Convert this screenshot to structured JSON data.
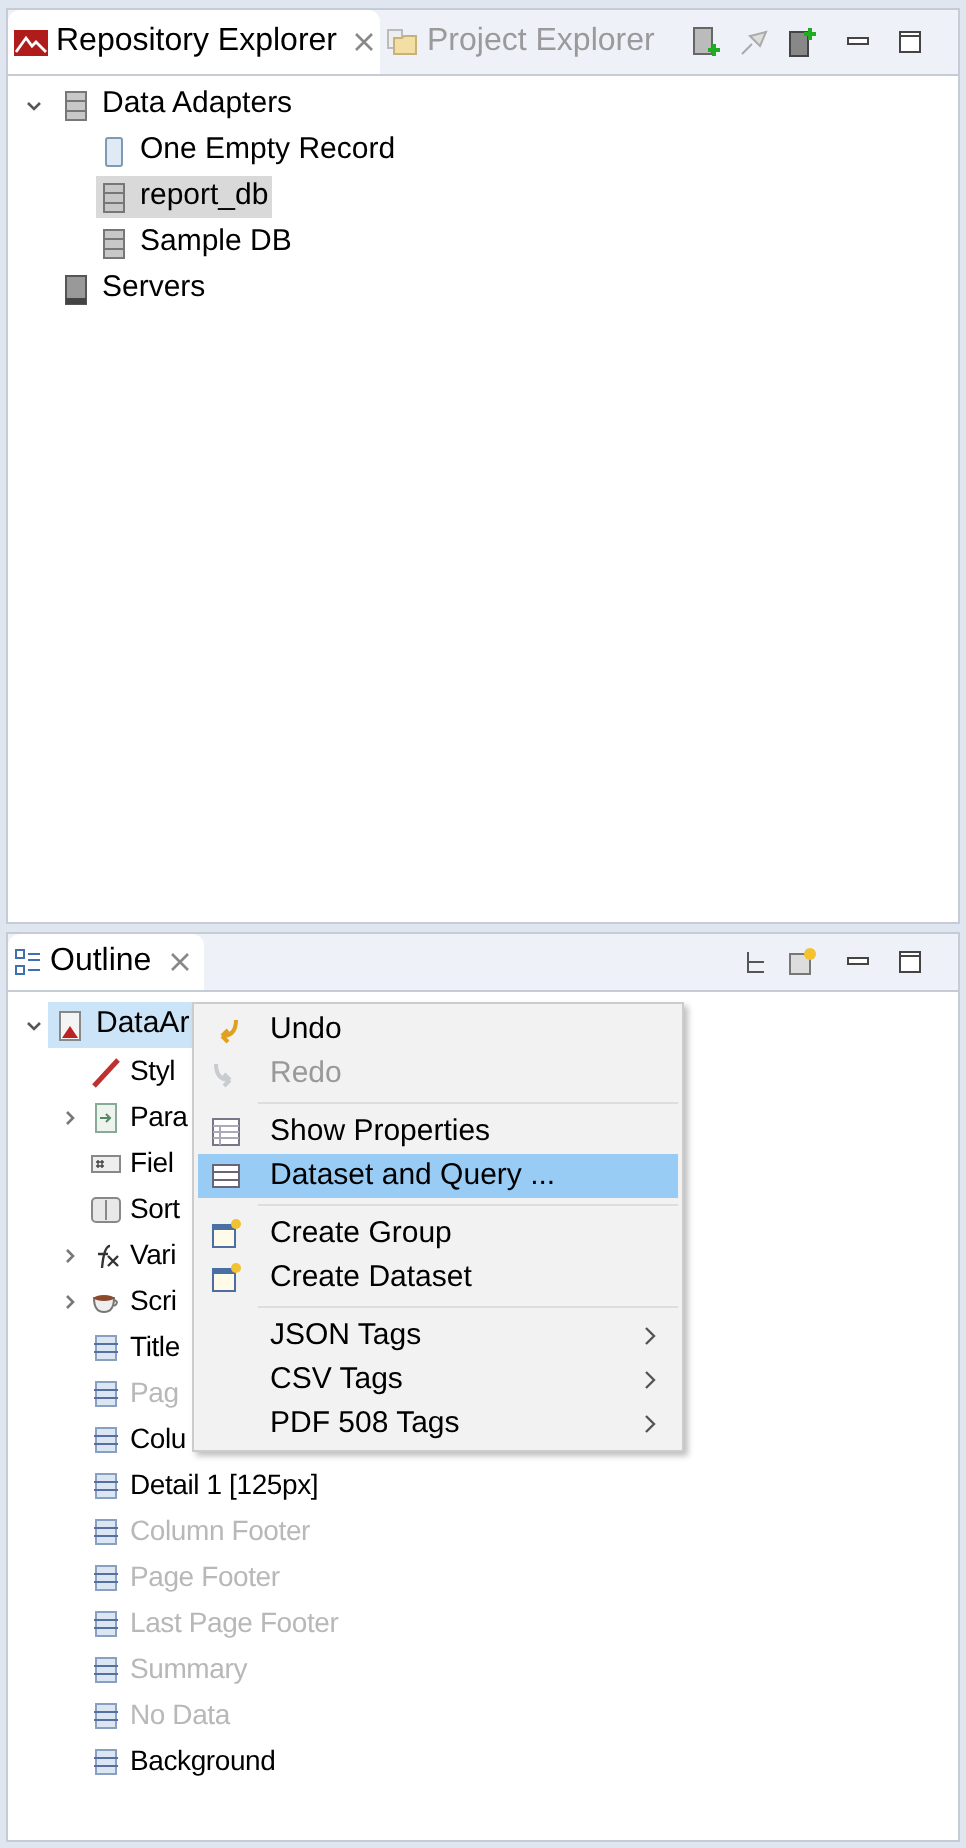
{
  "repository_panel": {
    "tabs": [
      {
        "label": "Repository Explorer",
        "selected": true
      },
      {
        "label": "Project Explorer",
        "selected": false
      }
    ],
    "tree": [
      {
        "label": "Data Adapters",
        "expanded": true,
        "selected": false,
        "children": [
          {
            "label": "One Empty Record",
            "selected": false
          },
          {
            "label": "report_db",
            "selected": true
          },
          {
            "label": "Sample DB",
            "selected": false
          }
        ]
      },
      {
        "label": "Servers",
        "selected": false
      }
    ]
  },
  "outline_panel": {
    "tab": {
      "label": "Outline",
      "selected": true
    },
    "root": {
      "label": "DataAr",
      "expanded": true,
      "selected": true,
      "children": [
        {
          "label": "Styl",
          "disabled": false
        },
        {
          "label": "Para",
          "disabled": false,
          "expanded": false
        },
        {
          "label": "Fiel",
          "disabled": false
        },
        {
          "label": "Sort",
          "disabled": false
        },
        {
          "label": "Vari",
          "disabled": false,
          "expanded": false
        },
        {
          "label": "Scri",
          "disabled": false,
          "expanded": false
        },
        {
          "label": "Title",
          "disabled": false
        },
        {
          "label": "Pag",
          "disabled": true
        },
        {
          "label": "Colu",
          "disabled": false
        },
        {
          "label": "Detail 1 [125px]",
          "disabled": false
        },
        {
          "label": "Column Footer",
          "disabled": true
        },
        {
          "label": "Page Footer",
          "disabled": true
        },
        {
          "label": "Last Page Footer",
          "disabled": true
        },
        {
          "label": "Summary",
          "disabled": true
        },
        {
          "label": "No Data",
          "disabled": true
        },
        {
          "label": "Background",
          "disabled": false
        }
      ]
    }
  },
  "context_menu": [
    {
      "kind": "item",
      "label": "Undo",
      "disabled": false,
      "selected": false
    },
    {
      "kind": "item",
      "label": "Redo",
      "disabled": true,
      "selected": false
    },
    {
      "kind": "separator"
    },
    {
      "kind": "item",
      "label": "Show Properties",
      "disabled": false,
      "selected": false
    },
    {
      "kind": "item",
      "label": "Dataset and Query ...",
      "disabled": false,
      "selected": true
    },
    {
      "kind": "separator"
    },
    {
      "kind": "item",
      "label": "Create Group",
      "disabled": false,
      "selected": false
    },
    {
      "kind": "item",
      "label": "Create Dataset",
      "disabled": false,
      "selected": false
    },
    {
      "kind": "separator"
    },
    {
      "kind": "submenu",
      "label": "JSON Tags",
      "disabled": false,
      "selected": false
    },
    {
      "kind": "submenu",
      "label": "CSV Tags",
      "disabled": false,
      "selected": false
    },
    {
      "kind": "submenu",
      "label": "PDF 508 Tags",
      "disabled": false,
      "selected": false
    }
  ]
}
